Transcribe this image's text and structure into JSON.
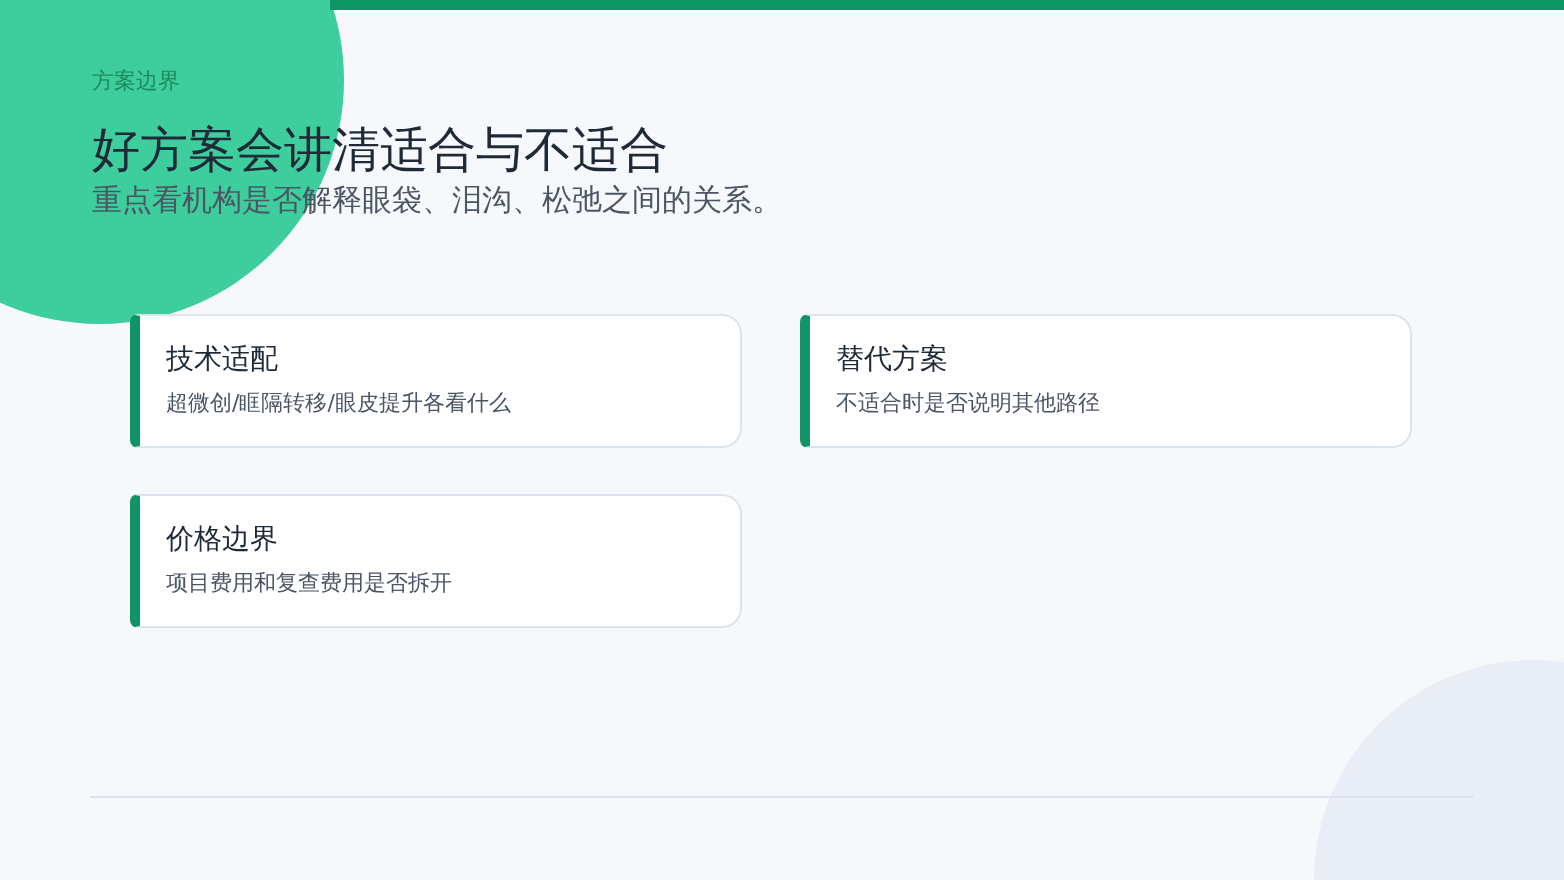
{
  "eyebrow": "方案边界",
  "title": "好方案会讲清适合与不适合",
  "subtitle": "重点看机构是否解释眼袋、泪沟、松弛之间的关系。",
  "cards": [
    {
      "title": "技术适配",
      "description": "超微创/眶隔转移/眼皮提升各看什么"
    },
    {
      "title": "替代方案",
      "description": "不适合时是否说明其他路径"
    },
    {
      "title": "价格边界",
      "description": "项目费用和复查费用是否拆开"
    }
  ]
}
